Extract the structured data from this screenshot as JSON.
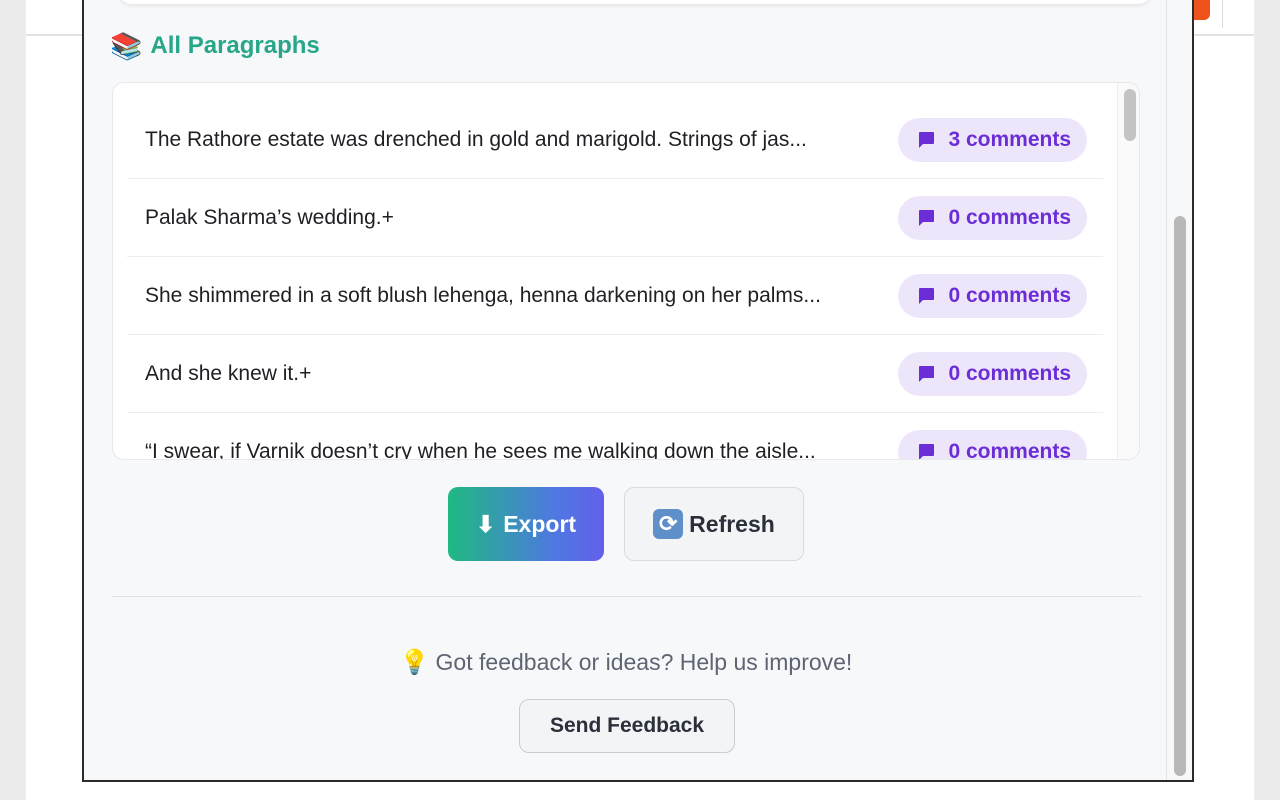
{
  "section": {
    "icon": "books-emoji",
    "title": "All Paragraphs"
  },
  "paragraphs": [
    {
      "text": "The Rathore estate was drenched in gold and marigold. Strings of jas...",
      "comments": "3 comments"
    },
    {
      "text": "Palak Sharma’s wedding.+",
      "comments": "0 comments"
    },
    {
      "text": "She shimmered in a soft blush lehenga, henna darkening on her palms...",
      "comments": "0 comments"
    },
    {
      "text": "And she knew it.+",
      "comments": "0 comments"
    },
    {
      "text": "“I swear, if Varnik doesn’t cry when he sees me walking down the aisle...",
      "comments": "0 comments"
    }
  ],
  "actions": {
    "export_label": "Export",
    "refresh_label": "Refresh"
  },
  "feedback": {
    "prompt": "Got feedback or ideas? Help us improve!",
    "button_label": "Send Feedback"
  },
  "colors": {
    "accent_green": "#27a689",
    "comment_purple": "#6b2ed6",
    "comment_pill_bg": "#ede6fb"
  }
}
